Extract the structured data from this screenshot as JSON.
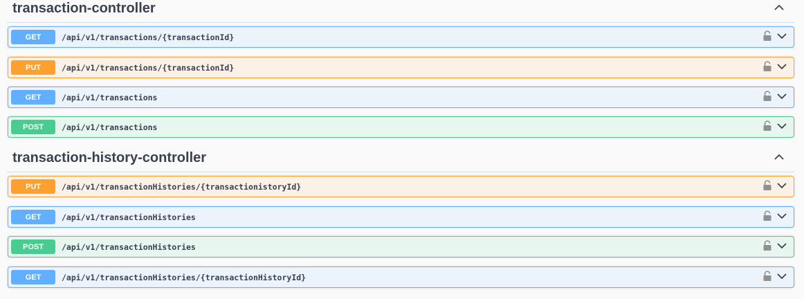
{
  "sections": [
    {
      "title": "transaction-controller",
      "ops": [
        {
          "method": "GET",
          "path": "/api/v1/transactions/{transactionId}"
        },
        {
          "method": "PUT",
          "path": "/api/v1/transactions/{transactionId}"
        },
        {
          "method": "GET",
          "path": "/api/v1/transactions"
        },
        {
          "method": "POST",
          "path": "/api/v1/transactions"
        }
      ]
    },
    {
      "title": "transaction-history-controller",
      "ops": [
        {
          "method": "PUT",
          "path": "/api/v1/transactionHistories/{transactionistoryId}"
        },
        {
          "method": "GET",
          "path": "/api/v1/transactionHistories"
        },
        {
          "method": "POST",
          "path": "/api/v1/transactionHistories"
        },
        {
          "method": "GET",
          "path": "/api/v1/transactionHistories/{transactionHistoryId}"
        }
      ]
    }
  ],
  "colors": {
    "get": "#61affe",
    "put": "#fca130",
    "post": "#49cc90"
  },
  "icons": {
    "collapse": "chevron-up-icon",
    "lock": "lock-icon",
    "expand": "chevron-down-icon"
  }
}
